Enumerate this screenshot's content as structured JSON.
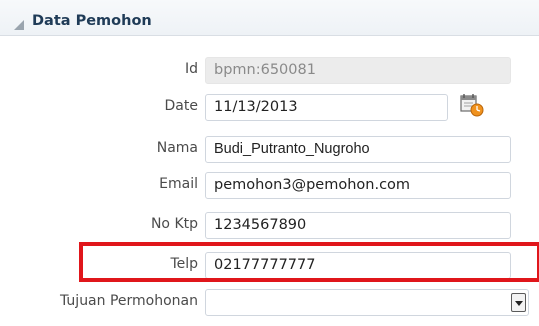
{
  "section": {
    "title": "Data Pemohon"
  },
  "fields": {
    "id": {
      "label": "Id",
      "value": "bpmn:650081"
    },
    "date": {
      "label": "Date",
      "value": "11/13/2013"
    },
    "nama": {
      "label": "Nama",
      "value": "Budi_Putranto_Nugroho"
    },
    "email": {
      "label": "Email",
      "value": "pemohon3@pemohon.com"
    },
    "no_ktp": {
      "label": "No Ktp",
      "value": "1234567890"
    },
    "telp": {
      "label": "Telp",
      "value": "02177777777"
    },
    "tujuan": {
      "label": "Tujuan Permohonan",
      "value": ""
    }
  },
  "icons": {
    "date_picker": "calendar-clock-icon",
    "collapse": "collapse-triangle-icon",
    "dropdown": "dropdown-arrow-icon"
  },
  "colors": {
    "highlight": "#e0161b",
    "header_title": "#1f3b57"
  }
}
